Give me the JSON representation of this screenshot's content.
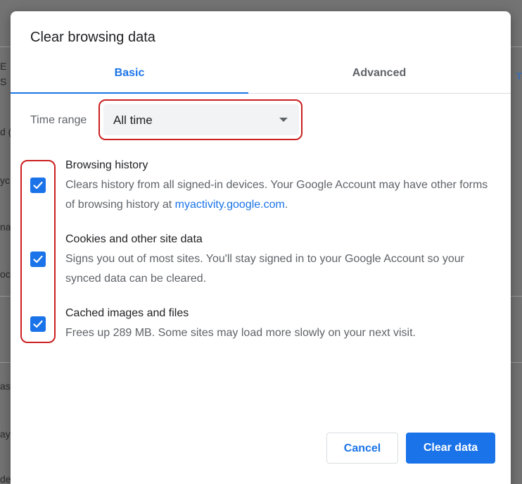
{
  "dialog": {
    "title": "Clear browsing data",
    "tabs": [
      {
        "label": "Basic",
        "active": true
      },
      {
        "label": "Advanced",
        "active": false
      }
    ],
    "time_range": {
      "label": "Time range",
      "value": "All time"
    },
    "options": [
      {
        "title": "Browsing history",
        "desc_before": "Clears history from all signed-in devices. Your Google Account may have other forms of browsing history at ",
        "link": "myactivity.google.com",
        "desc_after": ".",
        "checked": true
      },
      {
        "title": "Cookies and other site data",
        "desc": "Signs you out of most sites. You'll stay signed in to your Google Account so your synced data can be cleared.",
        "checked": true
      },
      {
        "title": "Cached images and files",
        "desc": "Frees up 289 MB. Some sites may load more slowly on your next visit.",
        "checked": true
      }
    ],
    "buttons": {
      "cancel": "Cancel",
      "clear": "Clear data"
    }
  },
  "background_fragments": [
    "E",
    "S",
    "d (",
    "yc",
    "na",
    "oc",
    "as",
    "ay",
    "de",
    "T"
  ],
  "colors": {
    "accent": "#1a73e8",
    "highlight": "#cc1f1f"
  }
}
